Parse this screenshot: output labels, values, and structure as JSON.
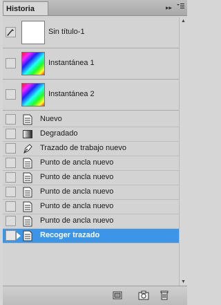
{
  "panel": {
    "tab_label": "Historia",
    "menu_arrows": "▸▸",
    "menu_icon": "menu-icon"
  },
  "snapshots": [
    {
      "label": "Sin título-1",
      "thumb": "white",
      "icon": "history-brush-icon"
    },
    {
      "label": "Instantánea 1",
      "thumb": "rainbow"
    },
    {
      "label": "Instantánea 2",
      "thumb": "rainbow"
    }
  ],
  "states": [
    {
      "label": "Nuevo",
      "icon": "document-state-icon"
    },
    {
      "label": "Degradado",
      "icon": "gradient-icon"
    },
    {
      "label": "Trazado de trabajo nuevo",
      "icon": "pen-tool-icon"
    },
    {
      "label": "Punto de ancla nuevo",
      "icon": "document-state-icon"
    },
    {
      "label": "Punto de ancla nuevo",
      "icon": "document-state-icon"
    },
    {
      "label": "Punto de ancla nuevo",
      "icon": "document-state-icon"
    },
    {
      "label": "Punto de ancla nuevo",
      "icon": "document-state-icon"
    },
    {
      "label": "Punto de ancla nuevo",
      "icon": "document-state-icon"
    },
    {
      "label": "Recoger trazado",
      "icon": "document-state-icon",
      "selected": true
    }
  ],
  "footer": {
    "buttons": [
      "new-document-from-state-icon",
      "camera-icon",
      "trash-icon"
    ]
  },
  "colors": {
    "selection": "#3d95e8"
  }
}
